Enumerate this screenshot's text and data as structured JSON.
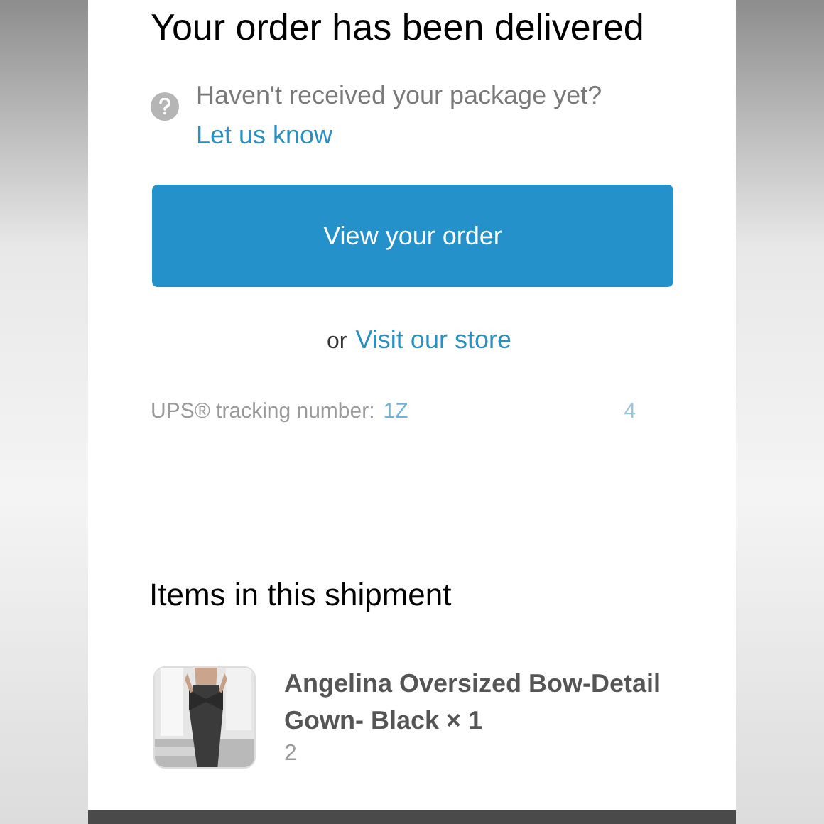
{
  "heading": "Your order has been delivered",
  "help": {
    "text": "Haven't received your package yet?",
    "link": "Let us know"
  },
  "primary_button": "View your order",
  "secondary": {
    "prefix": "or",
    "link": "Visit our store"
  },
  "tracking": {
    "label": "UPS® tracking number:",
    "number_start": "1Z",
    "number_end": "4"
  },
  "items_heading": "Items in this shipment",
  "items": [
    {
      "title": "Angelina Oversized Bow-Detail Gown- Black × 1",
      "subtitle": "2"
    }
  ]
}
